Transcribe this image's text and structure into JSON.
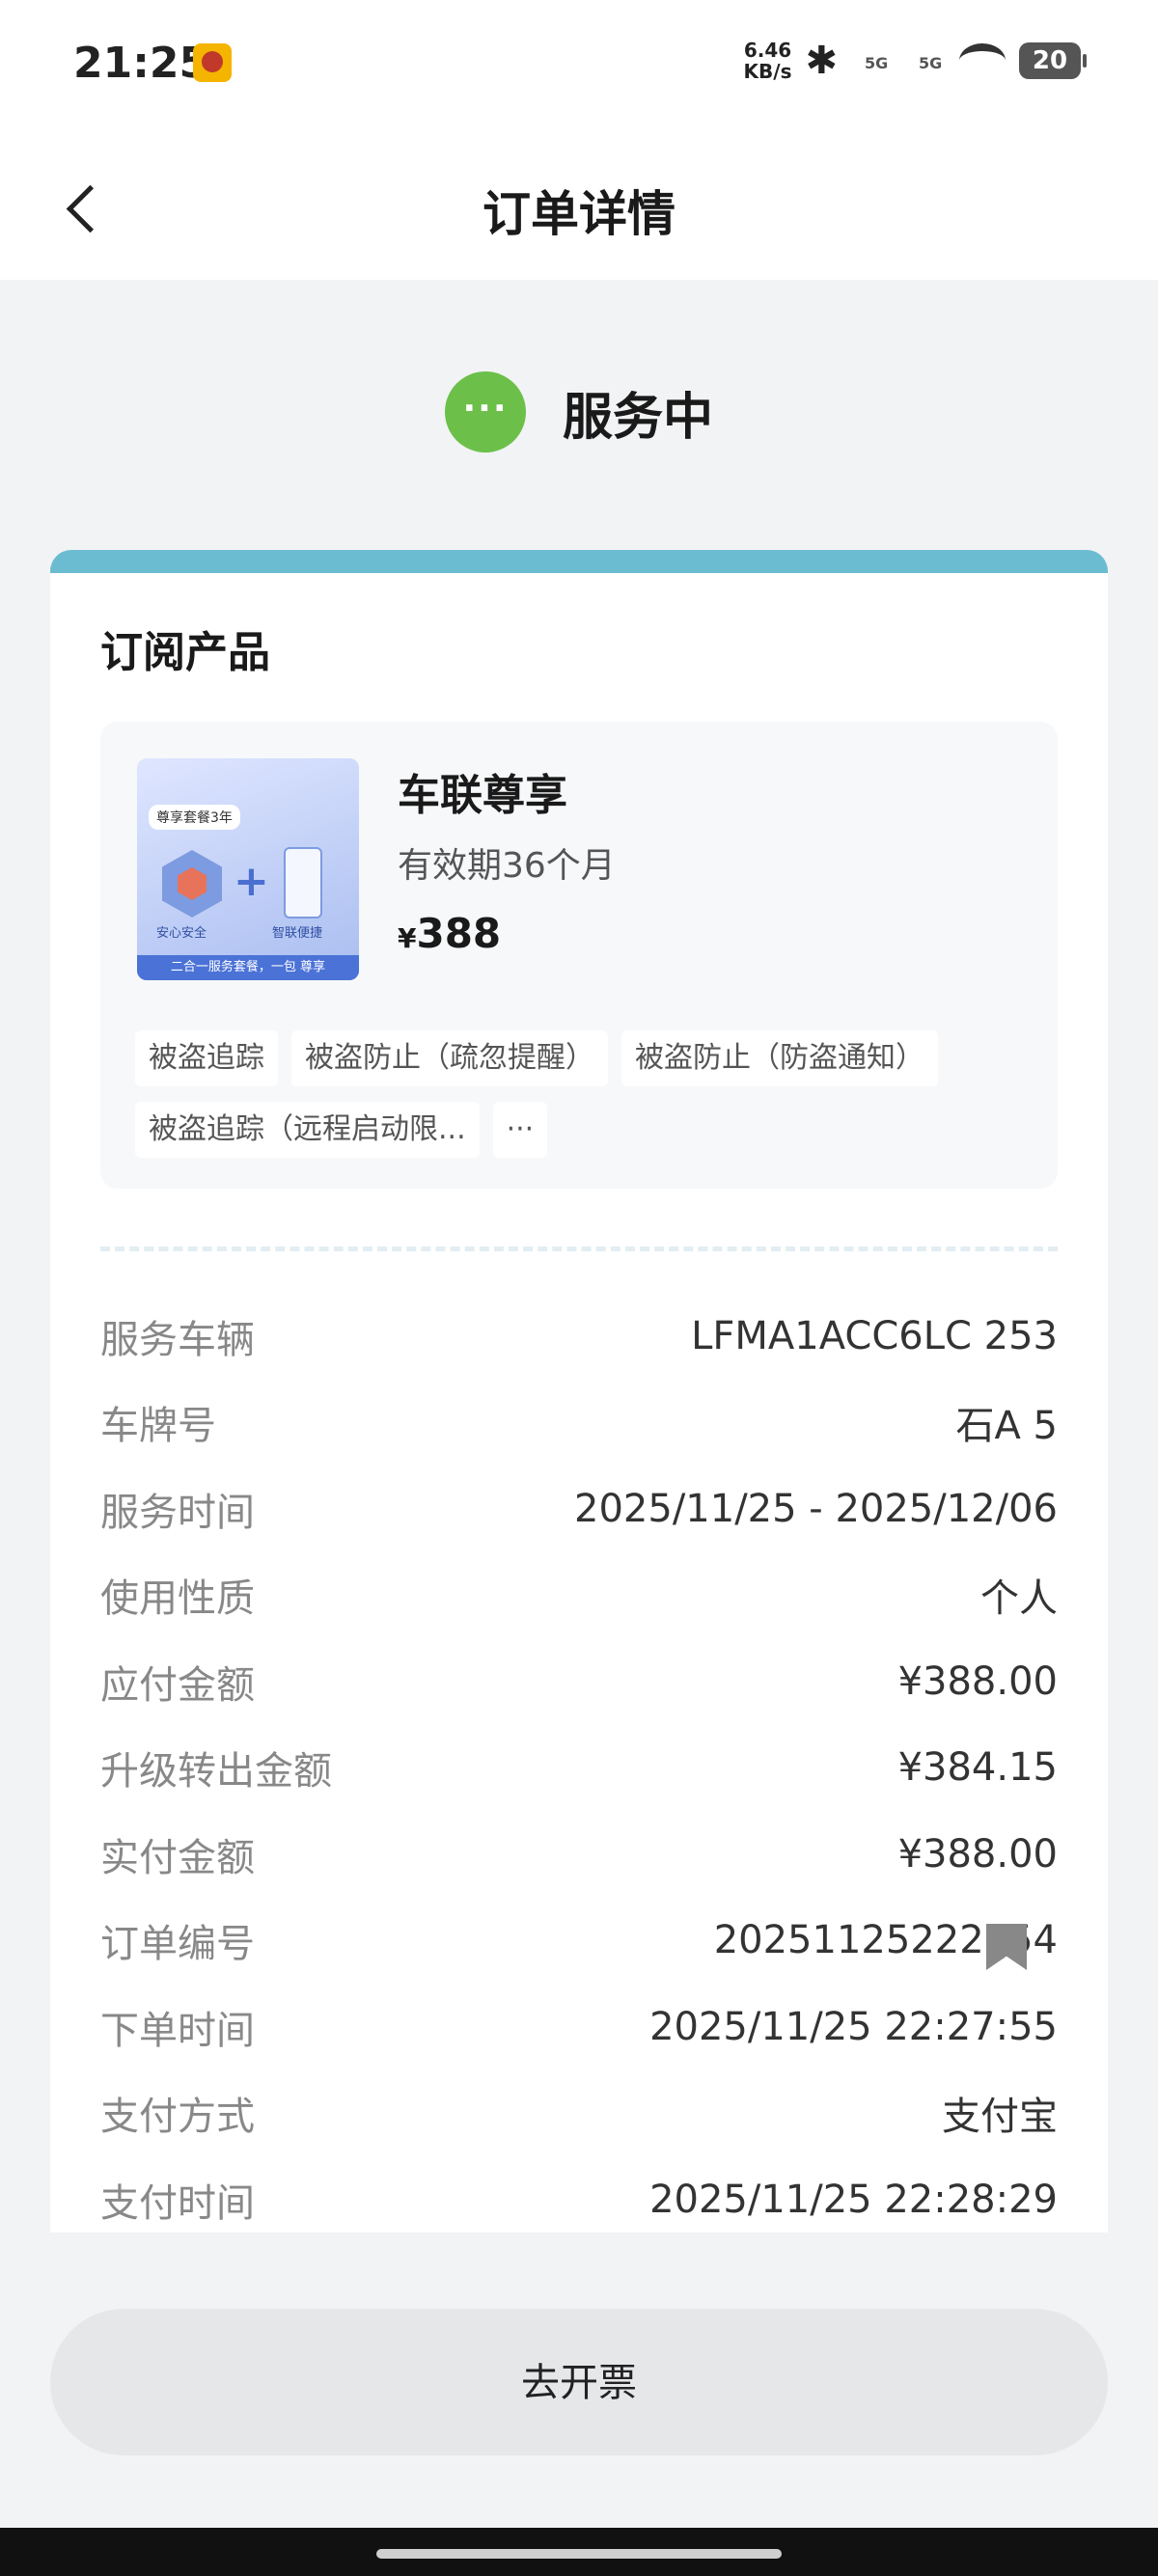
{
  "status_bar": {
    "time": "21:25",
    "network_speed_value": "6.46",
    "network_speed_unit": "KB/s",
    "signal1_label": "5G",
    "signal2_label": "5G",
    "battery": "20",
    "icons": [
      "app-notification-icon",
      "bluetooth-icon",
      "signal-icon",
      "signal-icon",
      "wifi-icon",
      "battery-icon"
    ]
  },
  "header": {
    "title": "订单详情",
    "back_icon": "chevron-left-icon"
  },
  "status": {
    "icon": "ellipsis-icon",
    "icon_text": "···",
    "text": "服务中",
    "color": "#6cc04a"
  },
  "product_section": {
    "title": "订阅产品",
    "accent_color": "#6bbcd1",
    "product": {
      "name": "车联尊享",
      "validity": "有效期36个月",
      "price_currency": "¥",
      "price_value": "388",
      "image": {
        "badge": "尊享套餐3年",
        "label_left": "安心安全",
        "label_right": "智联便捷",
        "bottom_text": "二合一服务套餐，一包 尊享"
      }
    },
    "tags": [
      "被盗追踪",
      "被盗防止（疏忽提醒）",
      "被盗防止（防盗通知）",
      "被盗追踪（远程启动限...",
      "···"
    ]
  },
  "details": [
    {
      "label": "服务车辆",
      "value": "LFMA1ACC6LC      253"
    },
    {
      "label": "车牌号",
      "value": "石A      5"
    },
    {
      "label": "服务时间",
      "value": "2025/11/25 - 2025/12/06"
    },
    {
      "label": "使用性质",
      "value": "个人"
    },
    {
      "label": "应付金额",
      "value": "¥388.00"
    },
    {
      "label": "升级转出金额",
      "value": "¥384.15"
    },
    {
      "label": "实付金额",
      "value": "¥388.00"
    },
    {
      "label": "订单编号",
      "value": "20251125222754     "
    },
    {
      "label": "下单时间",
      "value": "2025/11/25 22:27:55"
    },
    {
      "label": "支付方式",
      "value": "支付宝"
    },
    {
      "label": "支付时间",
      "value": "2025/11/25 22:28:29"
    }
  ],
  "actions": {
    "invoice_button": "去开票"
  }
}
